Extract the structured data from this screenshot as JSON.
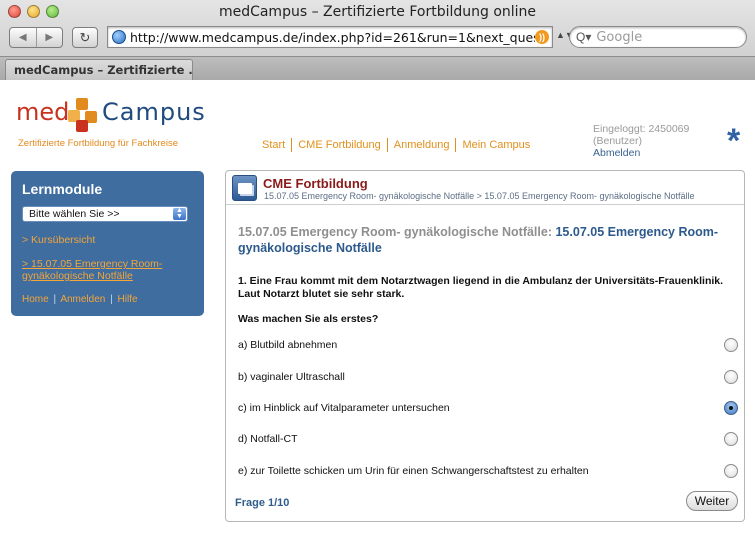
{
  "window": {
    "title": "medCampus – Zertifizierte Fortbildung online",
    "url": "http://www.medcampus.de/index.php?id=261&run=1&next_questio",
    "search_placeholder": "Google",
    "tab_label": "medCampus – Zertifizierte ..."
  },
  "site": {
    "logo_med": "med",
    "logo_campus": "Campus",
    "tagline": "Zertifizierte Fortbildung für Fachkreise",
    "nav": [
      "Start",
      "CME Fortbildung",
      "Anmeldung",
      "Mein Campus"
    ],
    "user_line1": "Eingeloggt: 2450069",
    "user_line2": "(Benutzer)",
    "logout": "Abmelden",
    "asterisk": "*"
  },
  "sidebar": {
    "title": "Lernmodule",
    "select_value": "Bitte wählen Sie >>",
    "link_overview": "> Kursübersicht",
    "link_course": "> 15.07.05 Emergency Room- gynäkologische Notfälle",
    "footer_home": "Home",
    "footer_login": "Anmelden",
    "footer_help": "Hilfe"
  },
  "panel": {
    "title": "CME Fortbildung",
    "breadcrumb_1": "15.07.05 Emergency Room- gynäkologische Notfälle",
    "breadcrumb_sep": ">",
    "breadcrumb_2": "15.07.05 Emergency Room- gynäkologische Notfälle",
    "heading_prefix": "15.07.05 Emergency Room- gynäkologische Notfälle:",
    "heading_accent": "15.07.05 Emergency Room- gynäkologische Notfälle",
    "question": "1. Eine Frau kommt mit dem Notarztwagen liegend in die Ambulanz der Universitäts-Frauenklinik. Laut Notarzt blutet sie sehr stark.",
    "prompt": "Was machen Sie als erstes?",
    "answers": [
      "a) Blutbild abnehmen",
      "b) vaginaler Ultraschall",
      "c) im Hinblick auf Vitalparameter untersuchen",
      "d) Notfall-CT",
      "e) zur Toilette schicken um Urin für einen Schwangerschaftstest zu erhalten"
    ],
    "selected_answer": "c) im Hinblick auf Vitalparameter untersuchen",
    "progress": "Frage 1/10",
    "next_button": "Weiter"
  }
}
